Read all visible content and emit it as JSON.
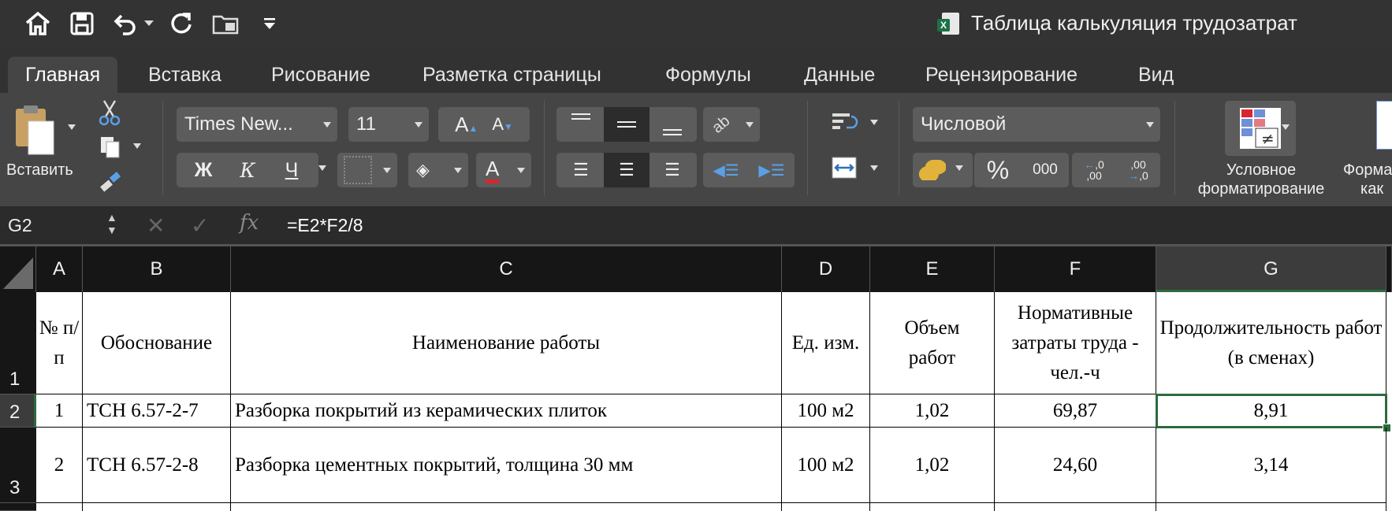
{
  "quick_access": {
    "icons": [
      "home-icon",
      "save-icon",
      "undo-icon",
      "redo-icon",
      "browse-icon",
      "customize-icon"
    ]
  },
  "document": {
    "title": "Таблица калькуляция трудозатрат"
  },
  "tabs": [
    "Главная",
    "Вставка",
    "Рисование",
    "Разметка страницы",
    "Формулы",
    "Данные",
    "Рецензирование",
    "Вид"
  ],
  "ribbon": {
    "paste_label": "Вставить",
    "font_name": "Times New...",
    "font_size": "11",
    "bold": "Ж",
    "italic": "К",
    "underline": "Ч",
    "number_format": "Числовой",
    "percent": "%",
    "thousands": "000",
    "conditional_formatting": "Условное форматирование",
    "conditional_line1": "Условное",
    "conditional_line2": "форматирование",
    "format_as_table_line1": "Форма",
    "format_as_table_line2": "как",
    "accent_red": "#d9252d"
  },
  "formula_bar": {
    "name_box": "G2",
    "fx": "fx",
    "formula": "=E2*F2/8"
  },
  "sheet": {
    "columns": [
      "A",
      "B",
      "C",
      "D",
      "E",
      "F",
      "G"
    ],
    "rows": [
      "1",
      "2",
      "3"
    ],
    "header_row": {
      "a": "№ п/п",
      "b": "Обоснование",
      "c": "Наименование работы",
      "d": "Ед. изм.",
      "e": "Объем работ",
      "f": "Нормативные затраты труда - чел.-ч",
      "g": "Продолжительность работ (в сменах)"
    },
    "data_rows": [
      {
        "a": "1",
        "b": "ТСН 6.57-2-7",
        "c": "Разборка покрытий из керамических плиток",
        "d": "100 м2",
        "e": "1,02",
        "f": "69,87",
        "g": "8,91"
      },
      {
        "a": "2",
        "b": "ТСН 6.57-2-8",
        "c": "Разборка цементных покрытий, толщина 30 мм",
        "d": "100 м2",
        "e": "1,02",
        "f": "24,60",
        "g": "3,14"
      }
    ],
    "selected_cell": "G2",
    "selection_color": "#2d6a3f"
  }
}
